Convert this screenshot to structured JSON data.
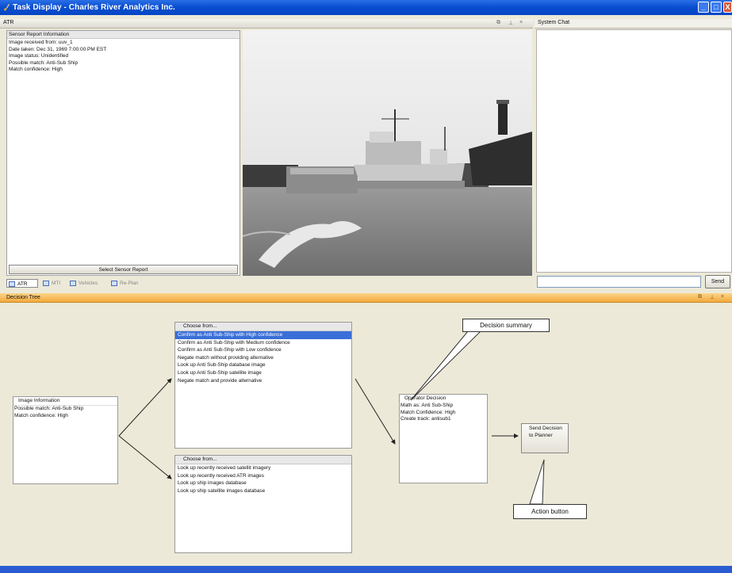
{
  "window": {
    "title": "Task Display - Charles River Analytics Inc."
  },
  "atr_panel": {
    "title": "ATR"
  },
  "sensor_report": {
    "header": "Sensor Report Information",
    "lines": [
      "Image received from: uuv_1",
      "Date taken: Dec 31, 1969 7:00:00 PM EST",
      "Image status: Unidentified",
      "Possible match: Anti-Sub Ship",
      "Match confidence: High"
    ],
    "select_button": "Select Sensor Report"
  },
  "tabs": [
    "ATR",
    "MTI",
    "Vehicles",
    "Re-Plan"
  ],
  "system_chat": {
    "title": "System Chat",
    "input_value": "",
    "send_button": "Send"
  },
  "decision_tree": {
    "title": "Decision Tree",
    "image_info": {
      "header": "Image Information",
      "lines": [
        "Possible match: Anti-Sub Ship",
        "Match confidence: High"
      ]
    },
    "chooser1": {
      "header": "Choose from...",
      "items": [
        "Confirm as Anti Sub-Ship with High confidence",
        "Confirm as Anti Sub-Ship with Medium confidence",
        "Confirm as Anti Sub-Ship with Low confidence",
        "Negate match without providing alternative",
        "Look up Anti Sub-Ship database image",
        "Look up Anti Sub-Ship satellite image",
        "Negate match and provide alternative"
      ],
      "selected_index": 0
    },
    "chooser2": {
      "header": "Choose from...",
      "items": [
        "Look up recently received satellit imagery",
        "Look up recently received ATR images",
        "Look up ship images database",
        "Look up ship satellite images database"
      ]
    },
    "operator_decision": {
      "header": "Operator Decision",
      "lines": [
        "Math as: Anti Sub-Ship",
        "Match Confidence: High",
        "Create track: antisub1"
      ]
    },
    "send_decision_button": "Send Decision to Planner",
    "callout_summary": "Decision summary",
    "callout_action": "Action button"
  },
  "colors": {
    "titlebar": "#0a4fd0",
    "selection": "#3a6fd8",
    "decision_header": "#f5a623"
  }
}
